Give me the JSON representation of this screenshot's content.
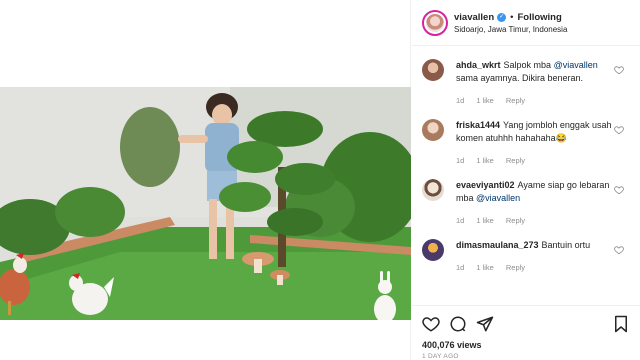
{
  "post": {
    "username": "viavallen",
    "follow_status": "Following",
    "location": "Sidoarjo, Jawa Timur, Indonesia",
    "likes": "400,076 views",
    "date": "1 DAY AGO"
  },
  "comments": [
    {
      "user": "ahda_wkrt",
      "text_before": "Salpok mba ",
      "mention": "@viavallen",
      "text_after": " sama ayamnya. Dikira beneran.",
      "age": "1d",
      "likes": "1 like",
      "reply": "Reply",
      "avatar_color": "#8a5a48"
    },
    {
      "user": "friska1444",
      "text_before": "Yang jombloh enggak usah komen atuhhh hahahaha😂",
      "mention": "",
      "text_after": "",
      "age": "1d",
      "likes": "1 like",
      "reply": "Reply",
      "avatar_color": "#c49a80"
    },
    {
      "user": "evaeviyanti02",
      "text_before": "Ayame siap go lebaran mba ",
      "mention": "@viavallen",
      "text_after": "",
      "age": "1d",
      "likes": "1 like",
      "reply": "Reply",
      "avatar_color": "#d9c6b8"
    },
    {
      "user": "dimasmaulana_273",
      "text_before": "Bantuin ortu",
      "mention": "",
      "text_after": "",
      "age": "1d",
      "likes": "1 like",
      "reply": "Reply",
      "avatar_color": "#4a3a6a"
    }
  ],
  "icons": {
    "like": "heart-icon",
    "comment": "comment-icon",
    "share": "share-icon",
    "save": "bookmark-icon",
    "verified": "verified-badge-icon"
  },
  "colors": {
    "verified": "#3897f0",
    "mention": "#00376b",
    "muted": "#8e8e8e"
  }
}
